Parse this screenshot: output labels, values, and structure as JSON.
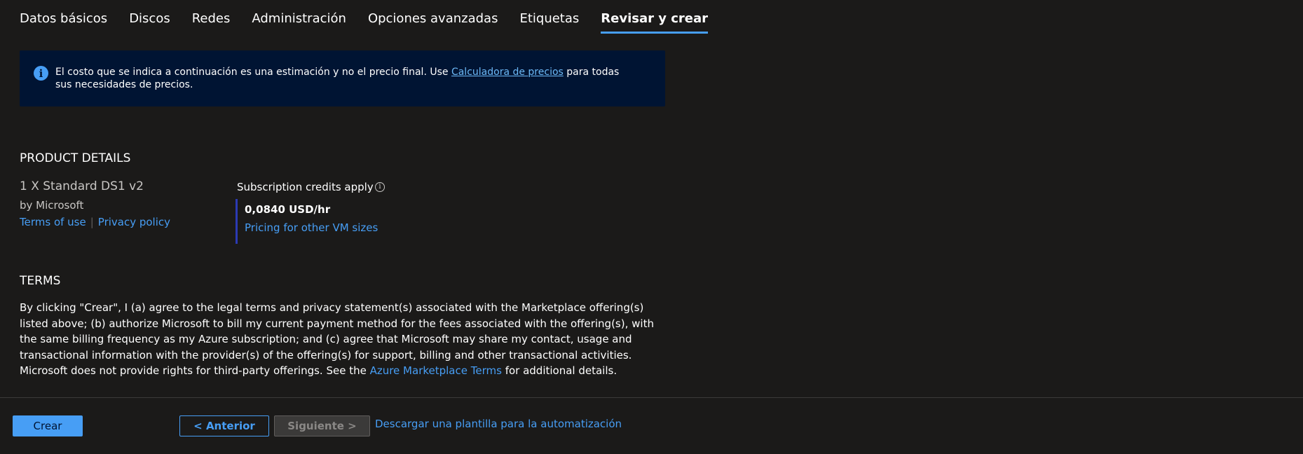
{
  "tabs": [
    {
      "label": "Datos básicos"
    },
    {
      "label": "Discos"
    },
    {
      "label": "Redes"
    },
    {
      "label": "Administración"
    },
    {
      "label": "Opciones avanzadas"
    },
    {
      "label": "Etiquetas"
    },
    {
      "label": "Revisar y crear",
      "active": true
    }
  ],
  "info_banner": {
    "icon": "info-icon",
    "text_before": "El costo que se indica a continuación es una estimación y no el precio final. Use ",
    "link": "Calculadora de precios",
    "text_after": " para todas sus necesidades de precios."
  },
  "product_details": {
    "title": "PRODUCT DETAILS",
    "name": "1 X Standard DS1 v2",
    "by": "by Microsoft",
    "terms_link": "Terms of use",
    "separator": "|",
    "privacy_link": "Privacy policy",
    "credits_label": "Subscription credits apply",
    "price": "0,0840 USD/hr",
    "pricing_link": "Pricing for other VM sizes"
  },
  "terms": {
    "title": "TERMS",
    "text_before": "By clicking \"Crear\", I (a) agree to the legal terms and privacy statement(s) associated with the Marketplace offering(s) listed above; (b) authorize Microsoft to bill my current payment method for the fees associated with the offering(s), with the same billing frequency as my Azure subscription; and (c) agree that Microsoft may share my contact, usage and transactional information with the provider(s) of the offering(s) for support, billing and other transactional activities. Microsoft does not provide rights for third-party offerings. See the ",
    "link": "Azure Marketplace Terms",
    "text_after": " for additional details."
  },
  "footer": {
    "create_label": "Crear",
    "prev_label": "< Anterior",
    "next_label": "Siguiente >",
    "download_link": "Descargar una plantilla para la automatización"
  },
  "colors": {
    "background": "#1b1a19",
    "accent": "#479ef5",
    "banner": "#001433"
  }
}
